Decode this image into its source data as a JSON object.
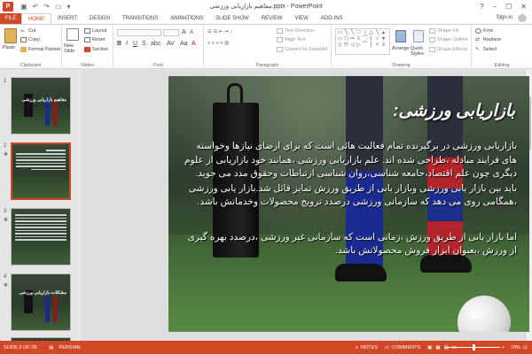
{
  "app": {
    "window_title": "مفاهیم بازاریابی ورزشی.pptx - PowerPoint",
    "sign_in": "Sign in",
    "window_controls": [
      "?",
      "–",
      "☐",
      "✕"
    ]
  },
  "quick_access": [
    "save-icon",
    "undo-icon",
    "redo-icon",
    "start-icon"
  ],
  "tabs": [
    {
      "label": "FILE",
      "active": false
    },
    {
      "label": "HOME",
      "active": true
    },
    {
      "label": "INSERT",
      "active": false
    },
    {
      "label": "DESIGN",
      "active": false
    },
    {
      "label": "TRANSITIONS",
      "active": false
    },
    {
      "label": "ANIMATIONS",
      "active": false
    },
    {
      "label": "SLIDE SHOW",
      "active": false
    },
    {
      "label": "REVIEW",
      "active": false
    },
    {
      "label": "VIEW",
      "active": false
    },
    {
      "label": "ADD-INS",
      "active": false
    }
  ],
  "ribbon": {
    "clipboard": {
      "label": "Clipboard",
      "paste": "Paste",
      "cut": "Cut",
      "copy": "Copy",
      "format_painter": "Format Painter"
    },
    "slides": {
      "label": "Slides",
      "new_slide": "New Slide",
      "layout": "Layout",
      "reset": "Reset",
      "section": "Section"
    },
    "font": {
      "label": "Font"
    },
    "paragraph": {
      "label": "Paragraph",
      "text_direction": "Text Direction",
      "align_text": "Align Text",
      "convert": "Convert to SmartArt"
    },
    "drawing": {
      "label": "Drawing",
      "arrange": "Arrange",
      "quick_styles": "Quick Styles",
      "shape_fill": "Shape Fill",
      "shape_outline": "Shape Outline",
      "shape_effects": "Shape Effects"
    },
    "editing": {
      "label": "Editing",
      "find": "Find",
      "replace": "Replace",
      "select": "Select"
    }
  },
  "thumbnails": [
    {
      "num": "1",
      "title": "مفاهیم بازاریابی ورزشی",
      "selected": false,
      "has_star": false
    },
    {
      "num": "2",
      "title": "",
      "selected": true,
      "has_star": true
    },
    {
      "num": "3",
      "title": "",
      "selected": false,
      "has_star": true
    },
    {
      "num": "4",
      "title": "مشکلات بازاریابی ورزشی",
      "selected": false,
      "has_star": true
    }
  ],
  "slide": {
    "title": "بازاریابی ورزشی:",
    "paragraphs": [
      "بازاریابی ورزشی در برگیرنده تمام فعالیت هائی است که برای ارضای نیازها وخواسته های فرایند مبادله ،طراحی شده اند. علم بازاریابی ورزشی ،همانند خود بازاریابی از علوم دیگری چون علم اقتصاد،جامعه شناسی،روان شناسی ارتباطات وحقوق مدد می جوید.",
      "باید بین بازار یابی ورزشی وبازار یابی از طریق ورزش تمایز قائل شد.بازار یابی ورزشی ،همگامی روی می دهد که سازمانی ورزشی درصدد ترویج محصولات وخدماتش باشد.",
      "اما بازار یابی از طریق ورزش ،زمانی است که سازمانی غیر ورزشی ،درصدد بهره گیری از ورزش ،بعنوان ابزار فروش محصولاتش باشد."
    ]
  },
  "status": {
    "slide_info": "SLIDE 2 OF 28",
    "language": "PERSIAN",
    "notes": "NOTES",
    "comments": "COMMENTS",
    "zoom": "74%"
  },
  "colors": {
    "accent": "#d24726",
    "ribbon_bg": "#ffffff",
    "workspace_bg": "#e6e6e6"
  }
}
